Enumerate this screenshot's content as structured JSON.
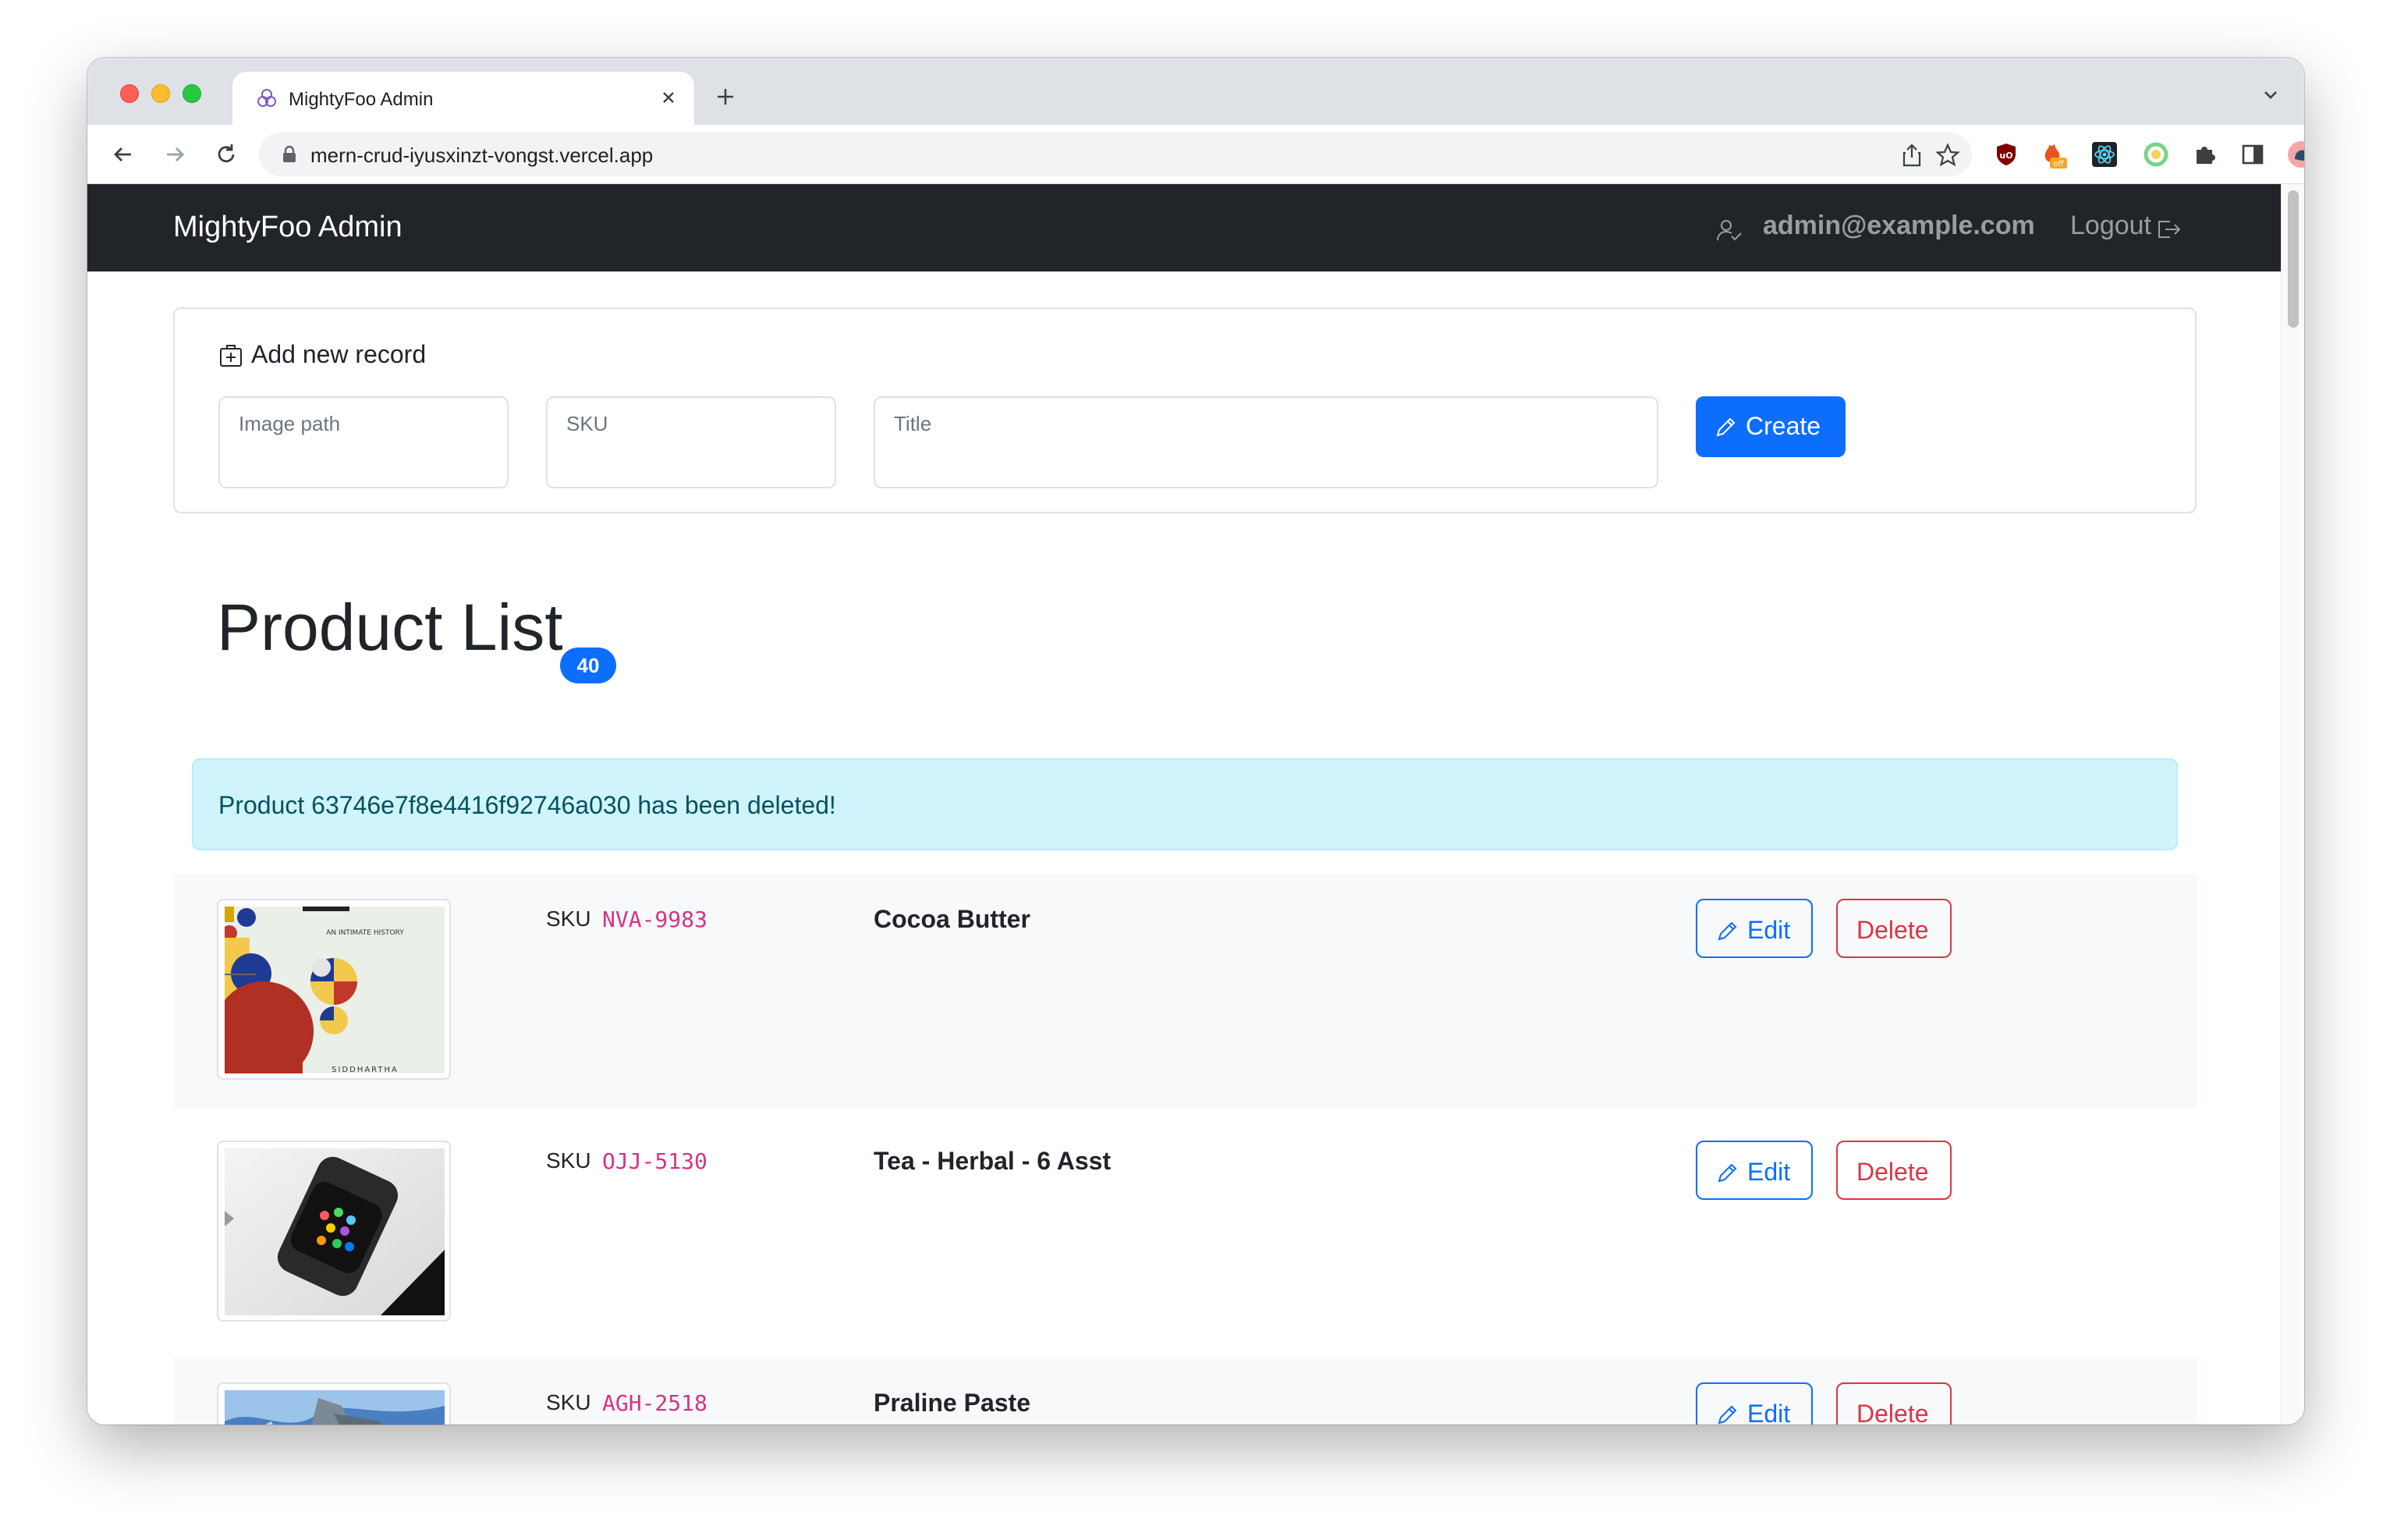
{
  "browser": {
    "tab_title": "MightyFoo Admin",
    "url": "mern-crud-iyusxinzt-vongst.vercel.app"
  },
  "navbar": {
    "brand": "MightyFoo Admin",
    "user_email": "admin@example.com",
    "logout_label": "Logout"
  },
  "add_form": {
    "title": "Add new record",
    "image_path_placeholder": "Image path",
    "sku_placeholder": "SKU",
    "title_placeholder": "Title",
    "create_label": "Create"
  },
  "product_list": {
    "heading": "Product List",
    "count": "40",
    "alert": "Product 63746e7f8e4416f92746a030 has been deleted!",
    "sku_prefix": "SKU",
    "edit_label": "Edit",
    "delete_label": "Delete",
    "items": [
      {
        "sku": "NVA-9983",
        "title": "Cocoa Butter",
        "image": "book-cover"
      },
      {
        "sku": "OJJ-5130",
        "title": "Tea - Herbal - 6 Asst",
        "image": "smartwatch"
      },
      {
        "sku": "AGH-2518",
        "title": "Praline Paste",
        "image": "robot-scene"
      }
    ],
    "image_text": {
      "book_subtitle": "AN INTIMATE HISTORY",
      "book_author": "SIDDHARTHA"
    }
  },
  "colors": {
    "primary": "#0d6efd",
    "danger": "#dc3545",
    "navbar": "#212529",
    "alert_bg": "#cff4fc",
    "code": "#d63384"
  }
}
